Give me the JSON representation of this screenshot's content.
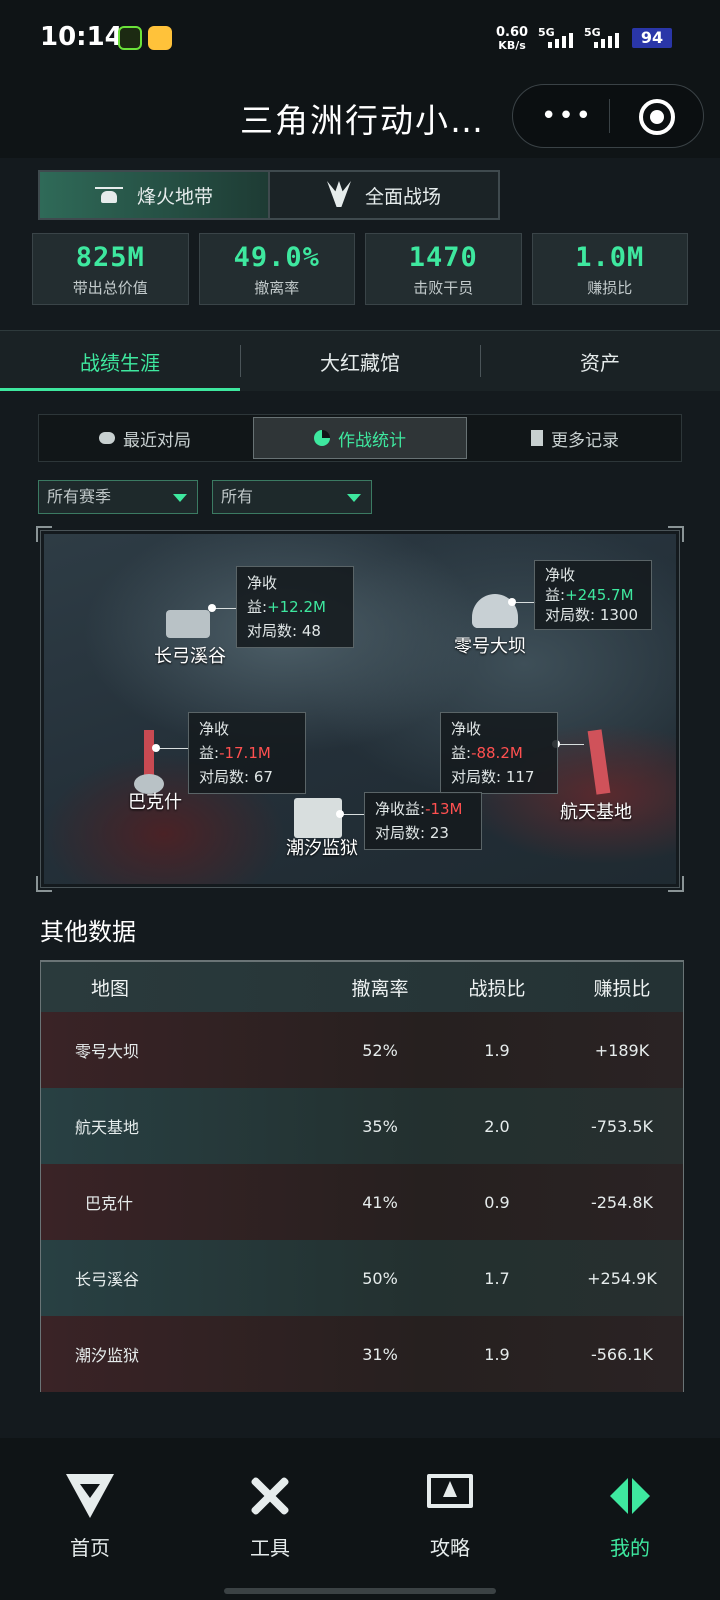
{
  "status_bar": {
    "time": "10:14",
    "network_speed_value": "0.60",
    "network_speed_unit": "KB/s",
    "sim1": "5G",
    "sim2": "5G",
    "battery": "94"
  },
  "title_bar": {
    "title": "三角洲行动小…",
    "more_icon": "more-dots-icon",
    "close_icon": "target-circle-icon"
  },
  "mode_tabs": [
    {
      "label": "烽火地带",
      "icon": "helicopter-icon",
      "active": true
    },
    {
      "label": "全面战场",
      "icon": "emblem-icon",
      "active": false
    }
  ],
  "stats": [
    {
      "value": "825M",
      "label": "带出总价值"
    },
    {
      "value": "49.0%",
      "label": "撤离率"
    },
    {
      "value": "1470",
      "label": "击败干员"
    },
    {
      "value": "1.0M",
      "label": "赚损比"
    }
  ],
  "section_tabs": [
    {
      "label": "战绩生涯",
      "active": true
    },
    {
      "label": "大红藏馆",
      "active": false
    },
    {
      "label": "资产",
      "active": false
    }
  ],
  "sub_tabs": [
    {
      "label": "最近对局",
      "icon": "gamepad-icon",
      "active": false
    },
    {
      "label": "作战统计",
      "icon": "pie-chart-icon",
      "active": true
    },
    {
      "label": "更多记录",
      "icon": "document-icon",
      "active": false
    }
  ],
  "filters": {
    "season": "所有赛季",
    "scope": "所有"
  },
  "map": {
    "net_label": "净收益:",
    "net_label_wrap_a": "净收",
    "net_label_wrap_b": "益:",
    "matches_label": "对局数:",
    "locations": [
      {
        "name": "长弓溪谷",
        "net": "+12.2M",
        "matches": "48"
      },
      {
        "name": "零号大坝",
        "net": "+245.7M",
        "matches": "1300"
      },
      {
        "name": "巴克什",
        "net": "-17.1M",
        "matches": "67"
      },
      {
        "name": "航天基地",
        "net": "-88.2M",
        "matches": "117"
      },
      {
        "name": "潮汐监狱",
        "net": "-13M",
        "matches": "23"
      }
    ]
  },
  "other_data": {
    "title": "其他数据",
    "headers": [
      "地图",
      "撤离率",
      "战损比",
      "赚损比"
    ],
    "rows": [
      {
        "map": "零号大坝",
        "extract": "52%",
        "kd": "1.9",
        "profit": "+189K"
      },
      {
        "map": "航天基地",
        "extract": "35%",
        "kd": "2.0",
        "profit": "-753.5K"
      },
      {
        "map": "巴克什",
        "extract": "41%",
        "kd": "0.9",
        "profit": "-254.8K"
      },
      {
        "map": "长弓溪谷",
        "extract": "50%",
        "kd": "1.7",
        "profit": "+254.9K"
      },
      {
        "map": "潮汐监狱",
        "extract": "31%",
        "kd": "1.9",
        "profit": "-566.1K"
      }
    ]
  },
  "bottom_nav": [
    {
      "label": "首页",
      "icon": "v-logo-icon",
      "active": false
    },
    {
      "label": "工具",
      "icon": "tools-icon",
      "active": false
    },
    {
      "label": "攻略",
      "icon": "monitor-icon",
      "active": false
    },
    {
      "label": "我的",
      "icon": "profile-emblem-icon",
      "active": true
    }
  ],
  "colors": {
    "accent": "#3ee89f",
    "negative": "#ff5050",
    "background": "#141a1e"
  }
}
